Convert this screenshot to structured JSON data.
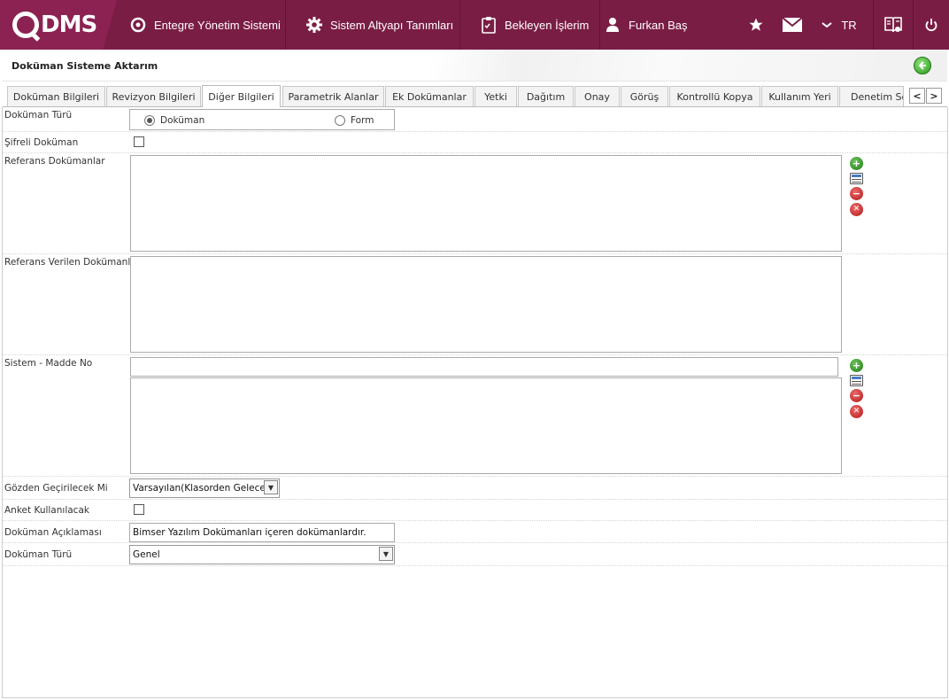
{
  "topbar": {
    "logo_text": "DMS",
    "nav": [
      {
        "label": "Entegre Yönetim Sistemi",
        "icon": "q-logo-icon"
      },
      {
        "label": "Sistem Altyapı Tanımları",
        "icon": "gear-icon"
      },
      {
        "label": "Bekleyen İşlerim",
        "icon": "clipboard-icon"
      },
      {
        "label": "Furkan Baş",
        "icon": "user-icon"
      }
    ],
    "language": "TR",
    "icons": [
      "star-icon",
      "mail-icon",
      "chevron-down-icon",
      "book-icon",
      "power-icon"
    ],
    "colors": {
      "bar": "#7a1d45",
      "logo_bg": "#8c2252"
    }
  },
  "page": {
    "title": "Doküman Sisteme Aktarım",
    "back_icon": "back-arrow-icon"
  },
  "tabs": [
    "Doküman Bilgileri",
    "Revizyon Bilgileri",
    "Diğer Bilgileri",
    "Parametrik Alanlar",
    "Ek Dokümanlar",
    "Yetki",
    "Dağıtım",
    "Onay",
    "Görüş",
    "Kontrollü Kopya",
    "Kullanım Yeri",
    "Denetim Sor"
  ],
  "active_tab": "Diğer Bilgileri",
  "form": {
    "doc_type": {
      "label": "Doküman Türü",
      "options": [
        "Doküman",
        "Form"
      ],
      "selected": "Doküman"
    },
    "encrypted": {
      "label": "Şifreli Doküman",
      "checked": false
    },
    "ref_docs": {
      "label": "Referans Dokümanlar"
    },
    "ref_given": {
      "label": "Referans Verilen Dokümanlar"
    },
    "system_item": {
      "label": "Sistem - Madde No",
      "value": ""
    },
    "review": {
      "label": "Gözden Geçirilecek Mi",
      "value": "Varsayılan(Klasorden Gelecek)"
    },
    "survey": {
      "label": "Anket Kullanılacak",
      "checked": false
    },
    "description": {
      "label": "Doküman Açıklaması",
      "value": "Bimser Yazılım Dokümanları içeren dokümanlardır."
    },
    "doc_type2": {
      "label": "Doküman Türü",
      "value": "Genel"
    }
  }
}
